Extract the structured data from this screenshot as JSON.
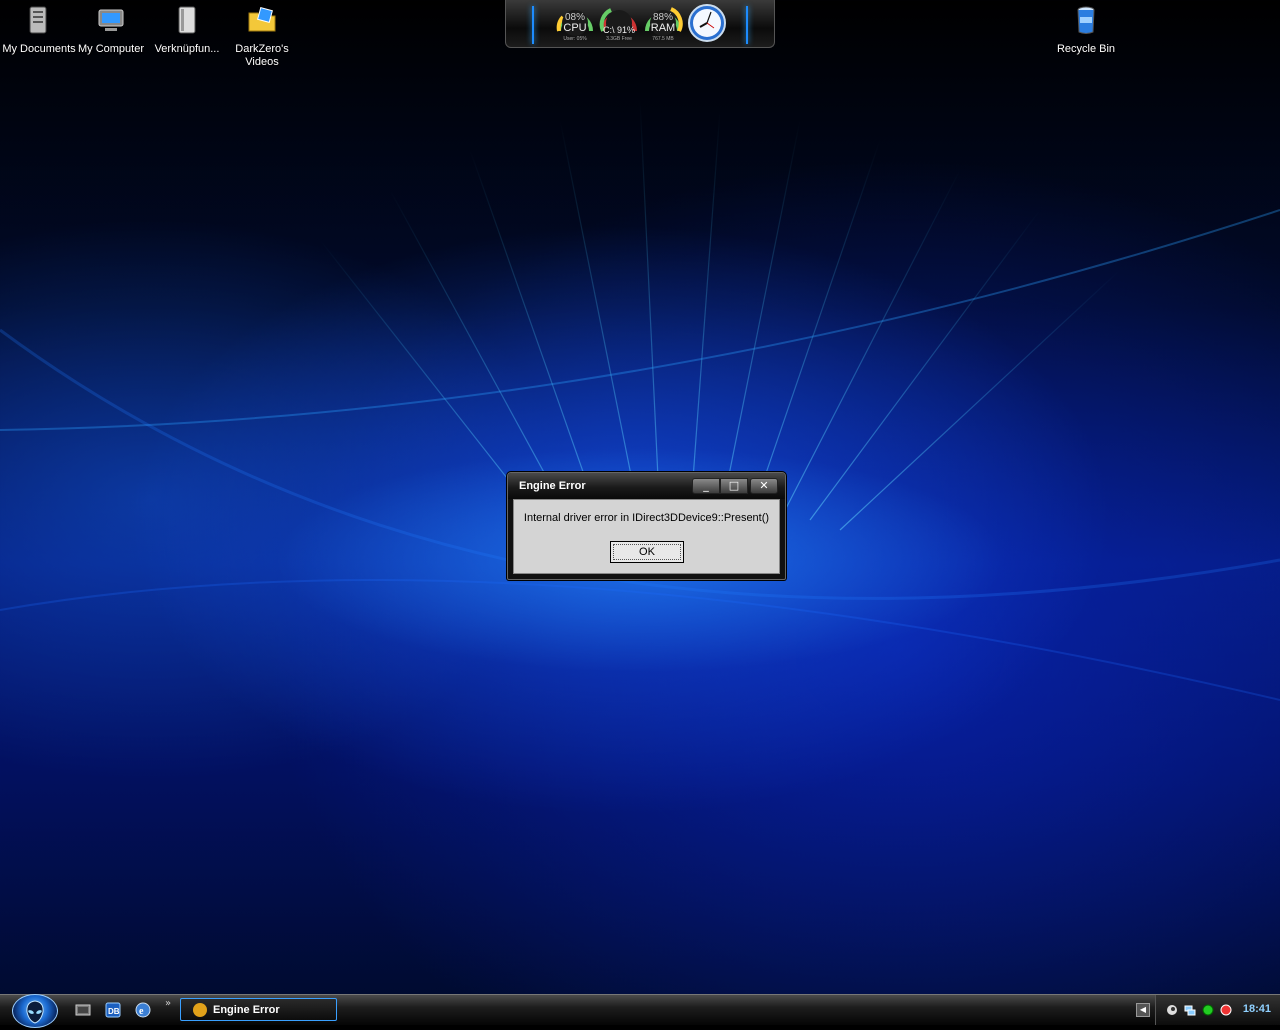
{
  "desktop": {
    "icons": [
      {
        "label": "My Documents",
        "icon": "documents-icon"
      },
      {
        "label": "My Computer",
        "icon": "computer-icon"
      },
      {
        "label": "Verknüpfun...",
        "icon": "shortcut-icon"
      },
      {
        "label": "DarkZero's Videos",
        "icon": "folder-icon"
      },
      {
        "label": "Recycle Bin",
        "icon": "recycle-bin-icon"
      }
    ]
  },
  "gadget": {
    "cpu": {
      "value": "08%",
      "label": "CPU",
      "sub": "User: 05%"
    },
    "disk": {
      "value": "C:\\ 91%",
      "sub": "3.3GB Free"
    },
    "ram": {
      "value": "88%",
      "label": "RAM",
      "sub": "767.5 MB"
    }
  },
  "dialog": {
    "title": "Engine Error",
    "message": "Internal driver error in IDirect3DDevice9::Present()",
    "ok_label": "OK",
    "minimize": "_",
    "maximize": "□",
    "close": "✕"
  },
  "taskbar": {
    "chevron": "»",
    "active_task": "Engine Error",
    "tray_arrow": "◀",
    "clock": "18:41"
  },
  "colors": {
    "accent": "#1d8cff",
    "clock": "#8fd0ff"
  }
}
